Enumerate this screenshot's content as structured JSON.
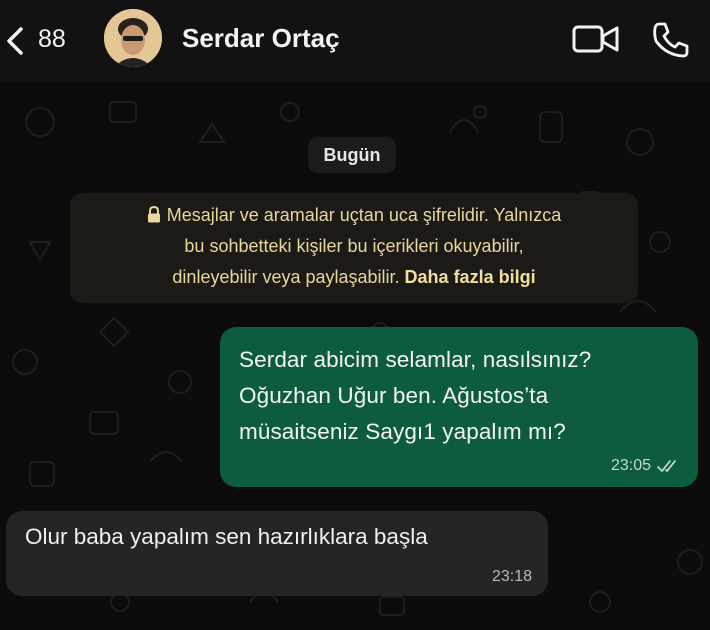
{
  "header": {
    "back_count": "88",
    "contact_name": "Serdar Ortaç",
    "icons": [
      "chevron-left-icon",
      "video-camera-icon",
      "phone-icon"
    ]
  },
  "chat": {
    "date_label": "Bugün",
    "encryption": {
      "line1": "Mesajlar ve aramalar uçtan uca şifrelidir. Yalnızca",
      "line2": "bu sohbetteki kişiler bu içerikleri okuyabilir,",
      "line3_prefix": "dinleyebilir veya paylaşabilir. ",
      "learn_more": "Daha fazla bilgi"
    },
    "messages": [
      {
        "direction": "outgoing",
        "lines": [
          "Serdar abicim selamlar, nasılsınız?",
          "Oğuzhan Uğur ben. Ağustos’ta",
          "müsaitseniz Saygı1 yapalım mı?"
        ],
        "time": "23:05",
        "status": "read"
      },
      {
        "direction": "incoming",
        "text": "Olur baba yapalım sen hazırlıklara başla",
        "time": "23:18"
      }
    ]
  },
  "colors": {
    "background": "#0b0b0b",
    "outgoing_bubble": "#0e5c3e",
    "incoming_bubble": "#252525",
    "notice_text": "#e9d79c"
  }
}
